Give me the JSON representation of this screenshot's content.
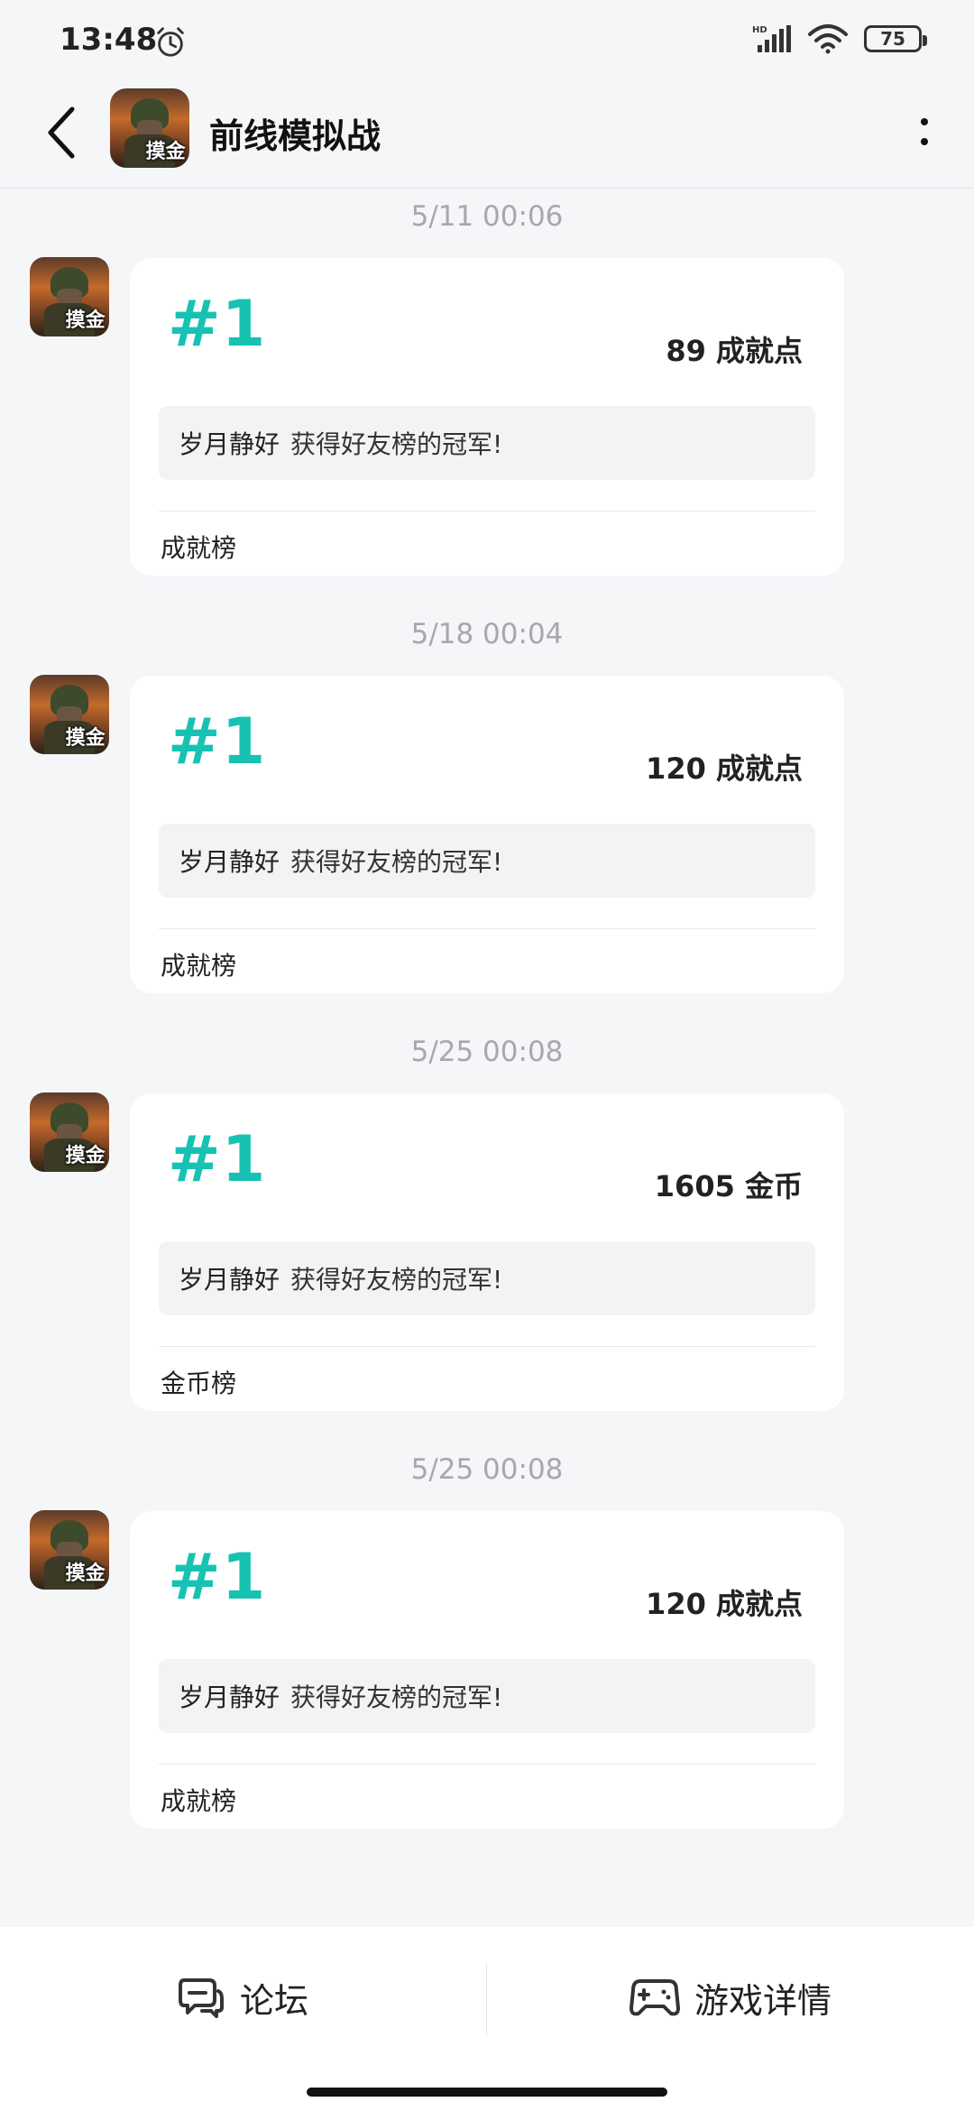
{
  "status": {
    "time": "13:48",
    "network": "HD",
    "battery": "75"
  },
  "header": {
    "title": "前线模拟战",
    "avatar_text": "摸金"
  },
  "messages": [
    {
      "timestamp": "5/11  00:06",
      "rank": "#1",
      "points": "89 成就点",
      "player": "岁月静好",
      "message": "获得好友榜的冠军!",
      "board": "成就榜"
    },
    {
      "timestamp": "5/18  00:04",
      "rank": "#1",
      "points": "120 成就点",
      "player": "岁月静好",
      "message": "获得好友榜的冠军!",
      "board": "成就榜"
    },
    {
      "timestamp": "5/25  00:08",
      "rank": "#1",
      "points": "1605 金币",
      "player": "岁月静好",
      "message": "获得好友榜的冠军!",
      "board": "金币榜"
    },
    {
      "timestamp": "5/25  00:08",
      "rank": "#1",
      "points": "120 成就点",
      "player": "岁月静好",
      "message": "获得好友榜的冠军!",
      "board": "成就榜"
    }
  ],
  "bottom_nav": {
    "forum": "论坛",
    "game_detail": "游戏详情"
  },
  "colors": {
    "accent": "#18c2b3",
    "background": "#f5f6f8"
  }
}
